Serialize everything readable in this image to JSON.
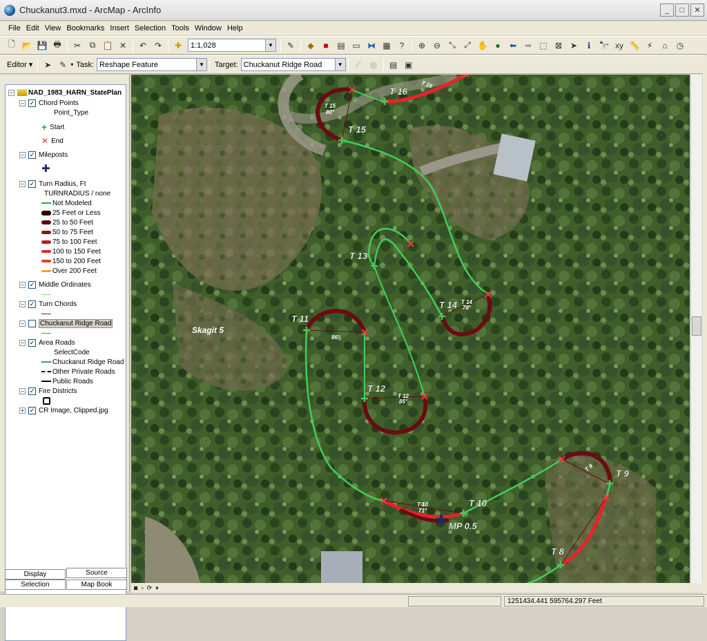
{
  "window": {
    "title": "Chuckanut3.mxd - ArcMap - ArcInfo",
    "min_label": "_",
    "max_label": "□",
    "close_label": "✕"
  },
  "menu": [
    "File",
    "Edit",
    "View",
    "Bookmarks",
    "Insert",
    "Selection",
    "Tools",
    "Window",
    "Help"
  ],
  "toolbar": {
    "scale_value": "1:1,028",
    "editor_label": "Editor ▾",
    "task_label": "Task:",
    "task_value": "Reshape Feature",
    "target_label": "Target:",
    "target_value": "Chuckanut Ridge Road"
  },
  "toc": {
    "root": "NAD_1983_HARN_StatePlan",
    "layers": {
      "chord_points": "Chord Points",
      "point_type": "Point_Type",
      "start": "Start",
      "end": "End",
      "mileposts": "Mileposts",
      "turn_radius": "Turn Radius, Ft",
      "turnradius_field": "TURNRADIUS / none",
      "not_modeled": "Not Modeled",
      "r25less": "25 Feet or Less",
      "r25_50": "25 to 50 Feet",
      "r50_75": "50 to 75 Feet",
      "r75_100": "75 to 100 Feet",
      "r100_150": "100 to 150 Feet",
      "r150_200": "150 to 200 Feet",
      "r200over": "Over 200 Feet",
      "middle_ordinates": "Middle Ordinates",
      "turn_chords": "Turn Chords",
      "chuckanut_ridge_road": "Chuckanut Ridge Road",
      "area_roads": "Area Roads",
      "select_code": "SelectCode",
      "ar_chuckanut": "Chuckanut Ridge Road",
      "ar_private": "Other Private Roads",
      "ar_public": "Public Roads",
      "fire_districts": "Fire Districts",
      "cr_image": "CR Image, Clipped.jpg"
    },
    "tabs": {
      "display": "Display",
      "source": "Source",
      "selection": "Selection",
      "map_book": "Map Book"
    }
  },
  "map_labels": {
    "skagit": "Skagit 5",
    "t16": "T 16",
    "t15": "T 15",
    "t13": "T 13",
    "t14": "T 14",
    "t11": "T 11",
    "t12": "T 12",
    "t10": "T 10",
    "t9": "T 9",
    "t8": "T 8",
    "mp": "MP 0.5",
    "t12_small": "T 12",
    "t12_angle": "85°",
    "t11_angle": "86°",
    "t10_small": "T 10",
    "t10_angle": "71°",
    "t14_small": "T 14",
    "t14_angle": "78°",
    "t16_small": "T 16",
    "t15_small": "T 15",
    "t15_angle": "80°",
    "t9_small": "T 9"
  },
  "colors": {
    "road_green": "#3ecf5a",
    "curve_dark": "#6a0c12",
    "curve_red": "#e8232a",
    "chord_red": "#e84040"
  },
  "status": {
    "coords": "1251434.441  595764.297 Feet"
  }
}
